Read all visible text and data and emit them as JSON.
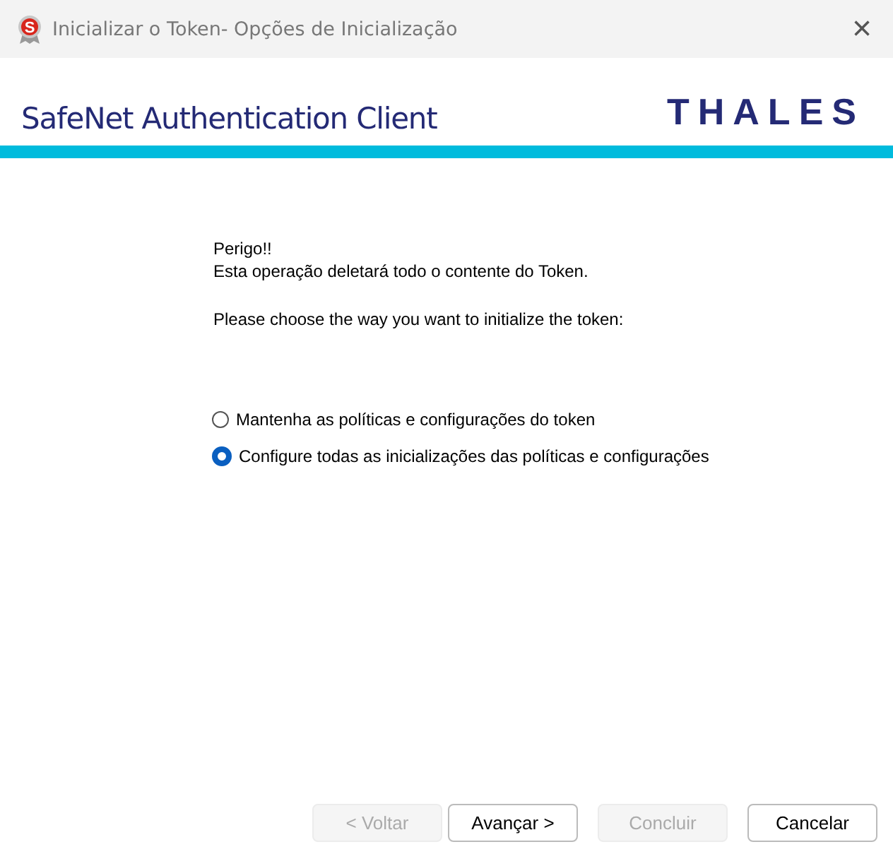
{
  "window": {
    "icon_letter": "S",
    "title": "Inicializar o Token- Opções de Inicialização",
    "close": "×"
  },
  "header": {
    "product": "SafeNet Authentication Client",
    "logo": "THALES"
  },
  "messages": [
    "Perigo!!\nEsta operação deletará todo o contente do Token.",
    "Please choose the way you want to initialize the token:"
  ],
  "options": [
    {
      "label": "Mantenha as políticas e configurações do token",
      "selected": false
    },
    {
      "label": "Configure todas as inicializações das políticas e configurações",
      "selected": true
    }
  ],
  "buttons": [
    {
      "label": "< Voltar",
      "disabled": true
    },
    {
      "label": "Avançar >",
      "disabled": false
    },
    {
      "label": "Concluir",
      "disabled": true
    },
    {
      "label": "Cancelar",
      "disabled": false
    }
  ]
}
